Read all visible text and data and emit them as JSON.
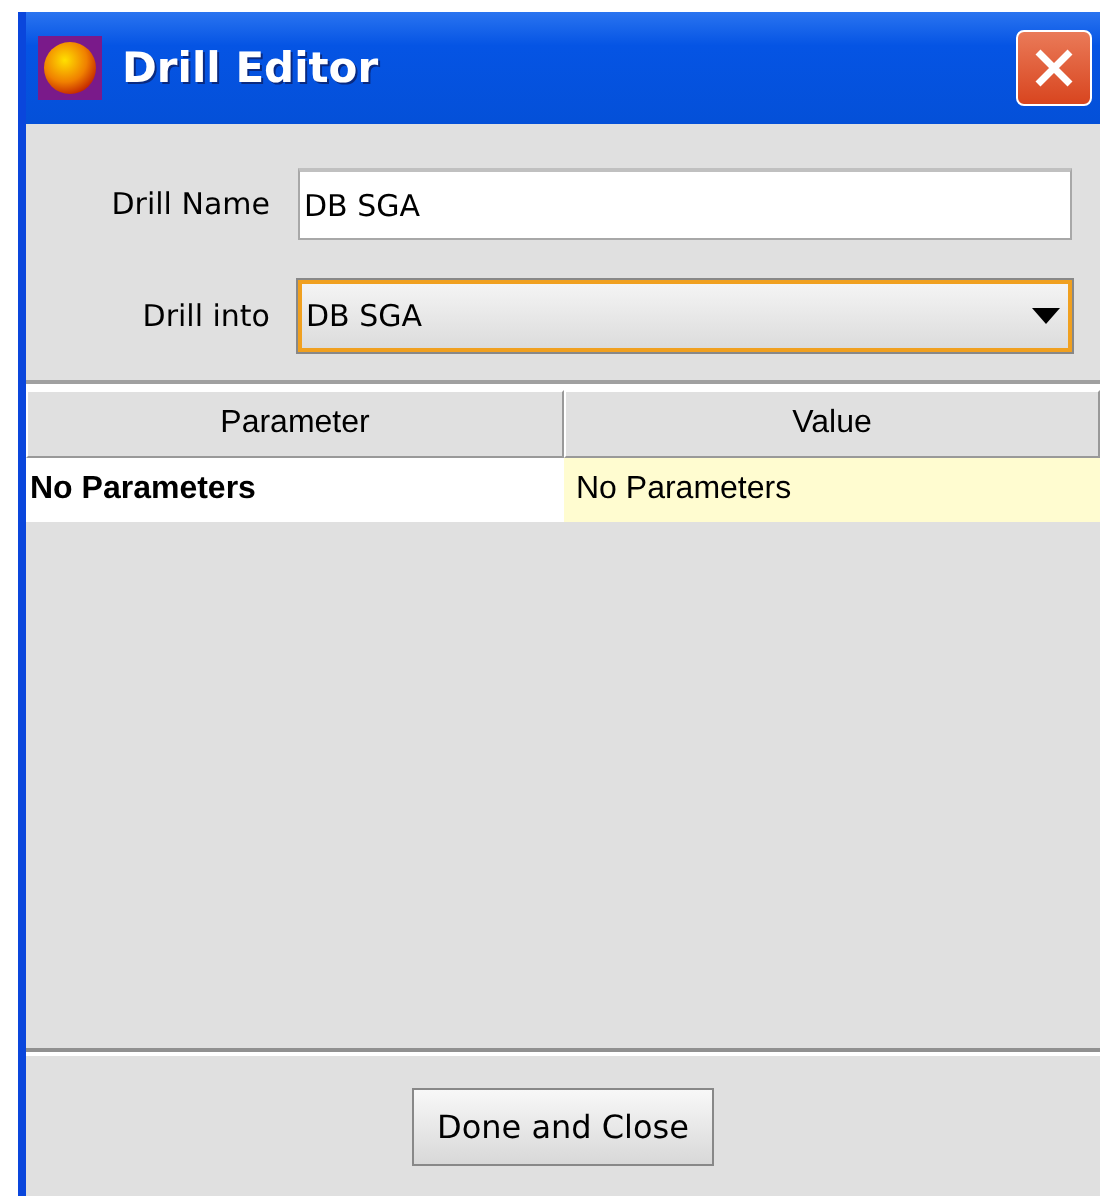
{
  "window": {
    "title": "Drill Editor"
  },
  "form": {
    "drill_name": {
      "label": "Drill Name",
      "value": "DB SGA"
    },
    "drill_into": {
      "label": "Drill into",
      "value": "DB SGA",
      "focused": true
    }
  },
  "table": {
    "columns": [
      "Parameter",
      "Value"
    ],
    "rows": [
      {
        "parameter": "No Parameters",
        "value": "No Parameters"
      }
    ]
  },
  "buttons": [
    "Done and Close"
  ]
}
